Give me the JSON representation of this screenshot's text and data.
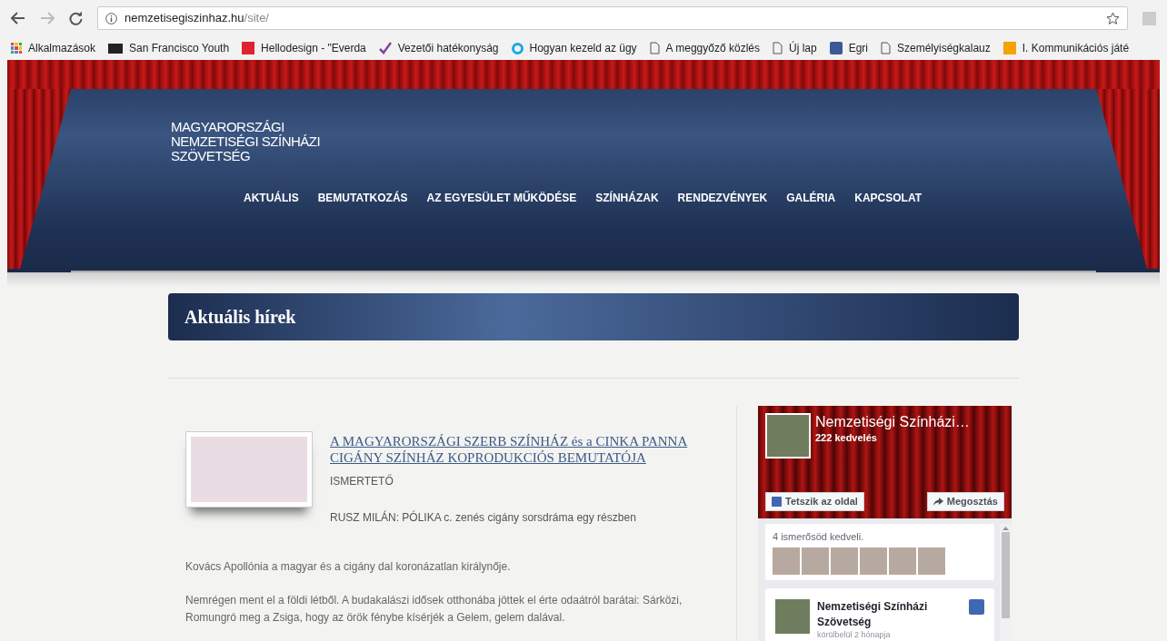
{
  "browser": {
    "url_host": "nemzetisegiszinhaz.hu",
    "url_path": "/site/",
    "bookmarks": [
      {
        "label": "Alkalmazások",
        "kind": "apps"
      },
      {
        "label": "San Francisco Youth",
        "kind": "dark"
      },
      {
        "label": "Hellodesign - \"Everda",
        "kind": "red"
      },
      {
        "label": "Vezetői hatékonyság",
        "kind": "check"
      },
      {
        "label": "Hogyan kezeld az ügy",
        "kind": "ring"
      },
      {
        "label": "A meggyőző közlés",
        "kind": "page"
      },
      {
        "label": "Új lap",
        "kind": "page"
      },
      {
        "label": "Egri",
        "kind": "facebook"
      },
      {
        "label": "Személyiségkalauz",
        "kind": "page"
      },
      {
        "label": "I. Kommunikációs játé",
        "kind": "orange"
      }
    ]
  },
  "site": {
    "logo": [
      "MAGYARORSZÁGI",
      "NEMZETISÉGI SZÍNHÁZI",
      "SZÖVETSÉG"
    ],
    "nav": [
      "AKTUÁLIS",
      "BEMUTATKOZÁS",
      "AZ EGYESÜLET MŰKÖDÉSE",
      "SZÍNHÁZAK",
      "RENDEZVÉNYEK",
      "GALÉRIA",
      "KAPCSOLAT"
    ],
    "section_title": "Aktuális hírek"
  },
  "article": {
    "title": "A MAGYARORSZÁGI SZERB SZÍNHÁZ és a CINKA PANNA CIGÁNY SZÍNHÁZ KOPRODUKCIÓS BEMUTATÓJA",
    "category": "ISMERTETŐ",
    "subtitle": "RUSZ MILÁN: PÓLIKA c. zenés cigány sorsdráma egy részben",
    "paragraphs": [
      "Kovács Apollónia a magyar és a cigány dal koronázatlan királynője.",
      "Nemrégen ment el a földi létből. A budakalászi idősek otthonába jöttek el érte odaátról barátai: Sárközi, Romungró meg a Zsiga, hogy az örök fénybe kísérjék a Gelem, gelem dalával."
    ]
  },
  "facebook": {
    "page_name": "Nemzetiségi Színházi…",
    "likes": "222 kedvelés",
    "like_button": "Tetszik az oldal",
    "share_button": "Megosztás",
    "friends_text": "4 ismerősöd kedveli.",
    "post": {
      "author": "Nemzetiségi Színházi Szövetség",
      "time": "körülbelül 2 hónapja"
    }
  }
}
